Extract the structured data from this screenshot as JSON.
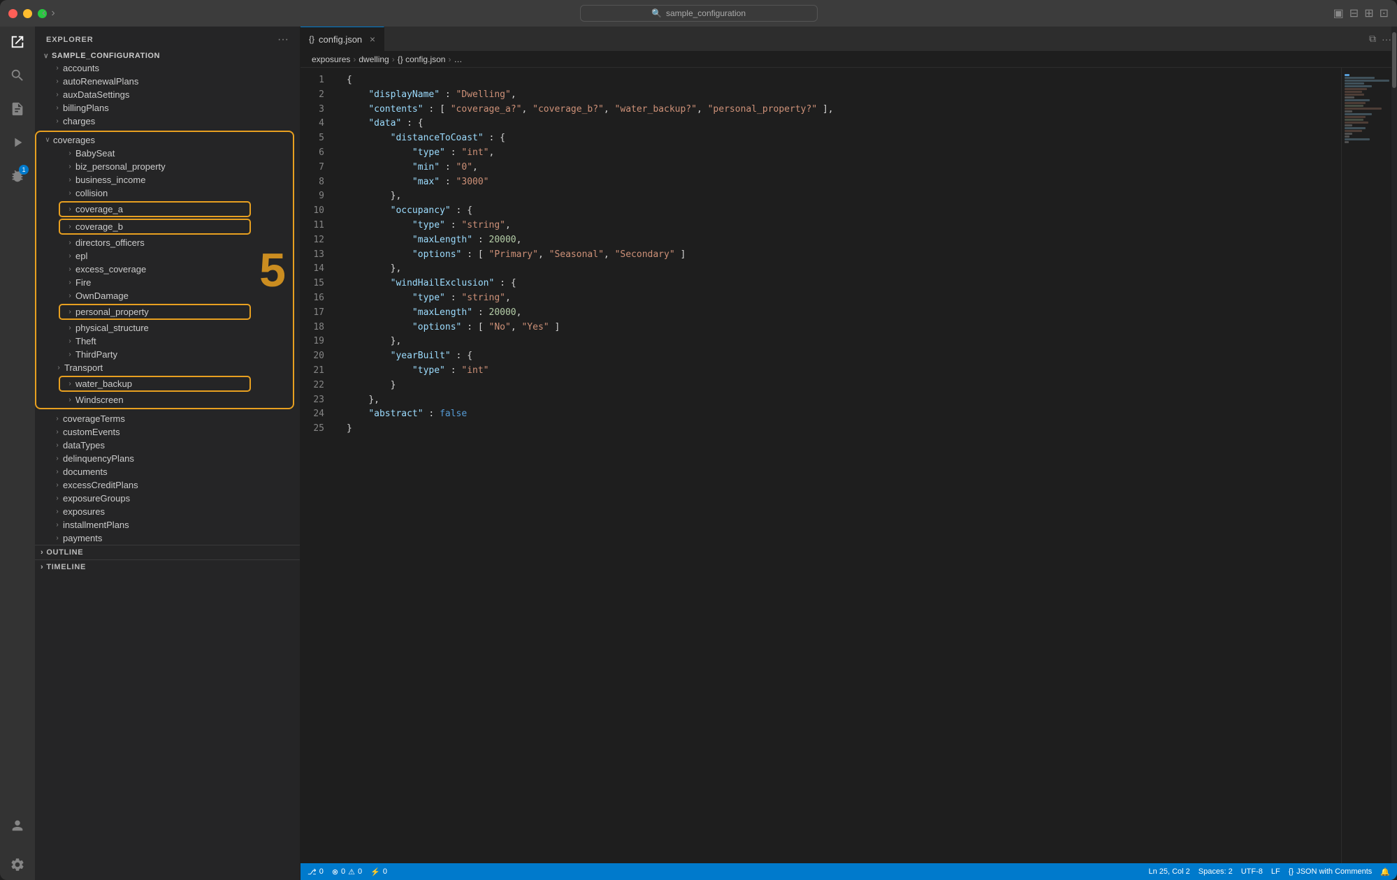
{
  "window": {
    "title": "sample_configuration"
  },
  "titlebar": {
    "back_arrow": "‹",
    "forward_arrow": "›",
    "search_placeholder": "sample_configuration",
    "icons": [
      "⊞",
      "⊟",
      "⊠",
      "⊡"
    ]
  },
  "activity_bar": {
    "icons": [
      {
        "name": "explorer-icon",
        "symbol": "📋",
        "active": true
      },
      {
        "name": "search-icon",
        "symbol": "🔍",
        "active": false
      },
      {
        "name": "source-control-icon",
        "symbol": "⑂",
        "active": false
      },
      {
        "name": "run-icon",
        "symbol": "▶",
        "active": false
      },
      {
        "name": "extensions-icon",
        "symbol": "⊞",
        "active": false,
        "badge": "1"
      }
    ]
  },
  "sidebar": {
    "header": "EXPLORER",
    "more_button": "···",
    "root": "SAMPLE_CONFIGURATION",
    "tree": [
      {
        "id": "accounts",
        "label": "accounts",
        "level": 1,
        "expanded": false,
        "arrow": "›"
      },
      {
        "id": "autoRenewalPlans",
        "label": "autoRenewalPlans",
        "level": 1,
        "expanded": false,
        "arrow": "›"
      },
      {
        "id": "auxDataSettings",
        "label": "auxDataSettings",
        "level": 1,
        "expanded": false,
        "arrow": "›"
      },
      {
        "id": "billingPlans",
        "label": "billingPlans",
        "level": 1,
        "expanded": false,
        "arrow": "›"
      },
      {
        "id": "charges",
        "label": "charges",
        "level": 1,
        "expanded": false,
        "arrow": "›"
      },
      {
        "id": "coverages",
        "label": "coverages",
        "level": 1,
        "expanded": true,
        "arrow": "∨",
        "highlighted_box": true
      },
      {
        "id": "BabySeat",
        "label": "BabySeat",
        "level": 2,
        "expanded": false,
        "arrow": "›"
      },
      {
        "id": "biz_personal_property",
        "label": "biz_personal_property",
        "level": 2,
        "expanded": false,
        "arrow": "›"
      },
      {
        "id": "business_income",
        "label": "business_income",
        "level": 2,
        "expanded": false,
        "arrow": "›"
      },
      {
        "id": "collision",
        "label": "collision",
        "level": 2,
        "expanded": false,
        "arrow": "›"
      },
      {
        "id": "coverage_a",
        "label": "coverage_a",
        "level": 2,
        "expanded": false,
        "arrow": "›",
        "orange_highlight": true
      },
      {
        "id": "coverage_b",
        "label": "coverage_b",
        "level": 2,
        "expanded": false,
        "arrow": "›",
        "orange_highlight": true
      },
      {
        "id": "directors_officers",
        "label": "directors_officers",
        "level": 2,
        "expanded": false,
        "arrow": "›"
      },
      {
        "id": "epl",
        "label": "epl",
        "level": 2,
        "expanded": false,
        "arrow": "›"
      },
      {
        "id": "excess_coverage",
        "label": "excess_coverage",
        "level": 2,
        "expanded": false,
        "arrow": "›"
      },
      {
        "id": "Fire",
        "label": "Fire",
        "level": 2,
        "expanded": false,
        "arrow": "›"
      },
      {
        "id": "OwnDamage",
        "label": "OwnDamage",
        "level": 2,
        "expanded": false,
        "arrow": "›"
      },
      {
        "id": "personal_property",
        "label": "personal_property",
        "level": 2,
        "expanded": false,
        "arrow": "›",
        "orange_highlight": true
      },
      {
        "id": "physical_structure",
        "label": "physical_structure",
        "level": 2,
        "expanded": false,
        "arrow": "›"
      },
      {
        "id": "Theft",
        "label": "Theft",
        "level": 2,
        "expanded": false,
        "arrow": "›"
      },
      {
        "id": "ThirdParty",
        "label": "ThirdParty",
        "level": 2,
        "expanded": false,
        "arrow": "›"
      },
      {
        "id": "Transport",
        "label": "Transport",
        "level": 2,
        "expanded": false,
        "arrow": "›"
      },
      {
        "id": "water_backup",
        "label": "water_backup",
        "level": 2,
        "expanded": false,
        "arrow": "›",
        "orange_highlight": true
      },
      {
        "id": "Windscreen",
        "label": "Windscreen",
        "level": 2,
        "expanded": false,
        "arrow": "›"
      },
      {
        "id": "coverageTerms",
        "label": "coverageTerms",
        "level": 1,
        "expanded": false,
        "arrow": "›"
      },
      {
        "id": "customEvents",
        "label": "customEvents",
        "level": 1,
        "expanded": false,
        "arrow": "›"
      },
      {
        "id": "dataTypes",
        "label": "dataTypes",
        "level": 1,
        "expanded": false,
        "arrow": "›"
      },
      {
        "id": "delinquencyPlans",
        "label": "delinquencyPlans",
        "level": 1,
        "expanded": false,
        "arrow": "›"
      },
      {
        "id": "documents",
        "label": "documents",
        "level": 1,
        "expanded": false,
        "arrow": "›"
      },
      {
        "id": "excessCreditPlans",
        "label": "excessCreditPlans",
        "level": 1,
        "expanded": false,
        "arrow": "›"
      },
      {
        "id": "exposureGroups",
        "label": "exposureGroups",
        "level": 1,
        "expanded": false,
        "arrow": "›"
      },
      {
        "id": "exposures",
        "label": "exposures",
        "level": 1,
        "expanded": false,
        "arrow": "›"
      },
      {
        "id": "installmentPlans",
        "label": "installmentPlans",
        "level": 1,
        "expanded": false,
        "arrow": "›"
      },
      {
        "id": "payments",
        "label": "payments",
        "level": 1,
        "expanded": false,
        "arrow": "›"
      }
    ],
    "bottom_sections": [
      "OUTLINE",
      "TIMELINE"
    ],
    "orange_number": "5"
  },
  "tab": {
    "icon": "{}",
    "label": "config.json",
    "close_icon": "×"
  },
  "breadcrumb": {
    "items": [
      "exposures",
      "dwelling",
      "{} config.json",
      "…"
    ]
  },
  "editor": {
    "lines": [
      {
        "num": 1,
        "code": "{"
      },
      {
        "num": 2,
        "code": "    <k>\"displayName\"</k> : <s>\"Dwelling\"</s>,"
      },
      {
        "num": 3,
        "code": "    <k>\"contents\"</k> : [ <s>\"coverage_a?\"</s>, <s>\"coverage_b?\"</s>, <s>\"water_backup?\"</s>, <s>\"personal_property?\"</s> ],"
      },
      {
        "num": 4,
        "code": "    <k>\"data\"</k> : {"
      },
      {
        "num": 5,
        "code": "        <k>\"distanceToCoast\"</k> : {"
      },
      {
        "num": 6,
        "code": "            <k>\"type\"</k> : <s>\"int\"</s>,"
      },
      {
        "num": 7,
        "code": "            <k>\"min\"</k> : <s>\"0\"</s>,"
      },
      {
        "num": 8,
        "code": "            <k>\"max\"</k> : <s>\"3000\"</s>"
      },
      {
        "num": 9,
        "code": "        },"
      },
      {
        "num": 10,
        "code": "        <k>\"occupancy\"</k> : {"
      },
      {
        "num": 11,
        "code": "            <k>\"type\"</k> : <s>\"string\"</s>,"
      },
      {
        "num": 12,
        "code": "            <k>\"maxLength\"</k> : <n>20000</n>,"
      },
      {
        "num": 13,
        "code": "            <k>\"options\"</k> : [ <s>\"Primary\"</s>, <s>\"Seasonal\"</s>, <s>\"Secondary\"</s> ]"
      },
      {
        "num": 14,
        "code": "        },"
      },
      {
        "num": 15,
        "code": "        <k>\"windHailExclusion\"</k> : {"
      },
      {
        "num": 16,
        "code": "            <k>\"type\"</k> : <s>\"string\"</s>,"
      },
      {
        "num": 17,
        "code": "            <k>\"maxLength\"</k> : <n>20000</n>,"
      },
      {
        "num": 18,
        "code": "            <k>\"options\"</k> : [ <s>\"No\"</s>, <s>\"Yes\"</s> ]"
      },
      {
        "num": 19,
        "code": "        },"
      },
      {
        "num": 20,
        "code": "        <k>\"yearBuilt\"</k> : {"
      },
      {
        "num": 21,
        "code": "            <k>\"type\"</k> : <s>\"int\"</s>"
      },
      {
        "num": 22,
        "code": "        }"
      },
      {
        "num": 23,
        "code": "    },"
      },
      {
        "num": 24,
        "code": "    <k>\"abstract\"</k> : <b>false</b>"
      },
      {
        "num": 25,
        "code": "}"
      }
    ]
  },
  "status_bar": {
    "left": [
      {
        "id": "git-icon",
        "text": "⎇ 0"
      },
      {
        "id": "error-icon",
        "text": "⊗ 0  ⚠ 0"
      },
      {
        "id": "extension-icon",
        "text": "⚡ 0"
      }
    ],
    "right": [
      {
        "id": "position",
        "text": "Ln 25, Col 2"
      },
      {
        "id": "spaces",
        "text": "Spaces: 2"
      },
      {
        "id": "encoding",
        "text": "UTF-8"
      },
      {
        "id": "eol",
        "text": "LF"
      },
      {
        "id": "language",
        "text": "{} JSON with Comments"
      },
      {
        "id": "bell",
        "text": "🔔"
      }
    ]
  }
}
